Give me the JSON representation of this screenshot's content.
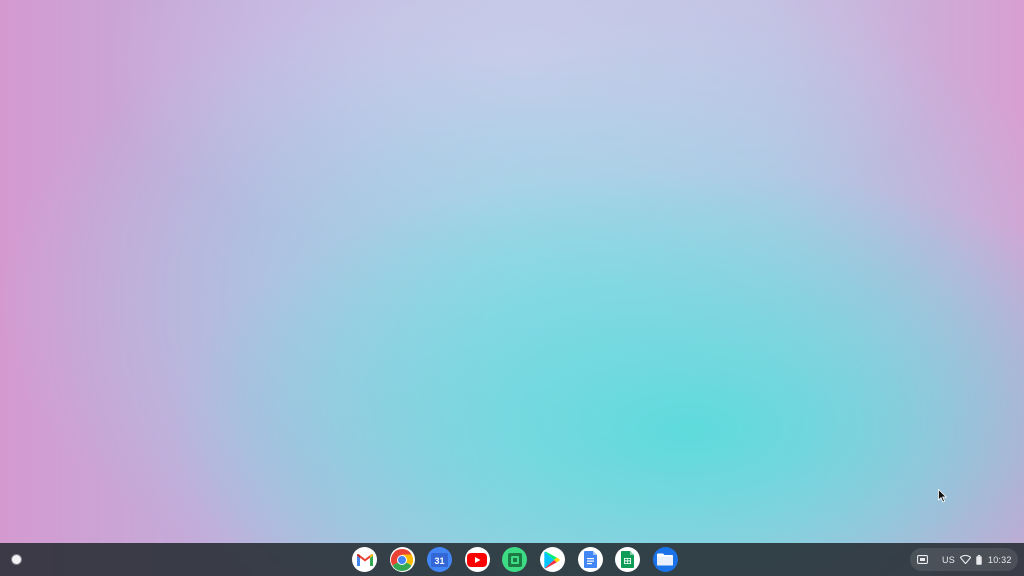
{
  "shelf": {
    "launcher_icon": "launcher-circle-icon",
    "pinned_apps": [
      {
        "id": "gmail",
        "icon": "gmail-icon"
      },
      {
        "id": "chrome",
        "icon": "chrome-icon"
      },
      {
        "id": "calendar",
        "icon": "calendar-icon",
        "label": "31"
      },
      {
        "id": "youtube",
        "icon": "youtube-icon"
      },
      {
        "id": "android-app",
        "icon": "android-app-icon"
      },
      {
        "id": "play-store",
        "icon": "play-store-icon"
      },
      {
        "id": "docs",
        "icon": "docs-icon"
      },
      {
        "id": "sheets",
        "icon": "sheets-icon"
      },
      {
        "id": "files",
        "icon": "files-folder-icon"
      }
    ],
    "status_tray": {
      "screen_capture_icon": "screen-capture-icon",
      "input_method": "US",
      "wifi_icon": "wifi-icon",
      "battery_icon": "battery-icon",
      "time": "10:32"
    }
  },
  "colors": {
    "shelf_bg": "#262c32",
    "gmail_red": "#ea4335",
    "google_blue": "#4285f4",
    "google_green": "#34a853",
    "google_yellow": "#fbbc04",
    "youtube_red": "#ff0000",
    "android_green": "#3ddc84",
    "files_blue": "#1a73e8"
  }
}
